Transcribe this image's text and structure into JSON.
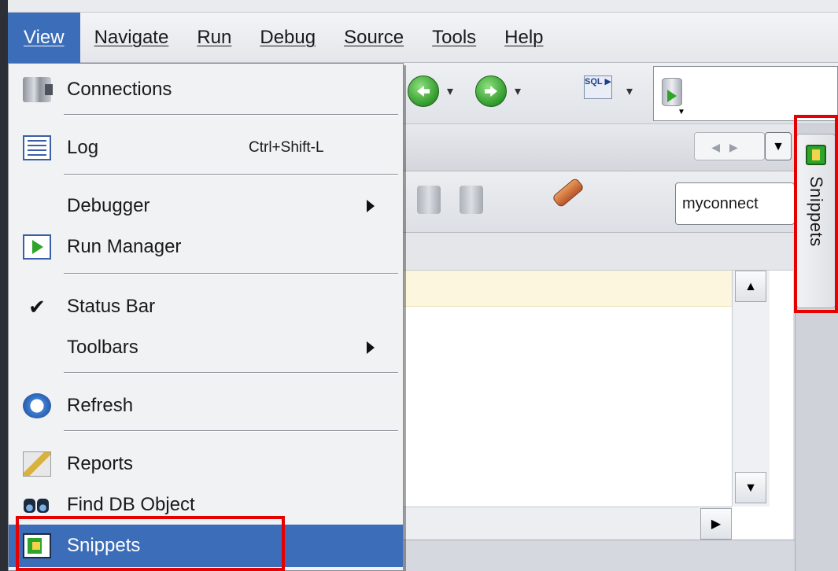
{
  "menubar": {
    "items": [
      {
        "label": "View",
        "active": true
      },
      {
        "label": "Navigate"
      },
      {
        "label": "Run"
      },
      {
        "label": "Debug"
      },
      {
        "label": "Source"
      },
      {
        "label": "Tools"
      },
      {
        "label": "Help"
      }
    ]
  },
  "view_menu": {
    "items": [
      {
        "label": "Connections",
        "icon": "connections-icon"
      },
      {
        "label": "Log",
        "shortcut": "Ctrl+Shift-L",
        "icon": "log-icon"
      },
      {
        "label": "Debugger",
        "submenu": true
      },
      {
        "label": "Run Manager",
        "icon": "run-manager-icon"
      },
      {
        "label": "Status Bar",
        "checked": true,
        "icon": "checkmark-icon"
      },
      {
        "label": "Toolbars",
        "submenu": true
      },
      {
        "label": "Refresh",
        "icon": "refresh-icon"
      },
      {
        "label": "Reports",
        "icon": "reports-icon"
      },
      {
        "label": "Find DB Object",
        "icon": "binoculars-icon"
      },
      {
        "label": "Snippets",
        "icon": "snippets-icon",
        "selected": true
      }
    ]
  },
  "toolbar": {
    "connection_select": "myconnect"
  },
  "side_panel": {
    "tab_label": "Snippets"
  },
  "colors": {
    "menu_highlight": "#3c6db8",
    "annotation_red": "#e60000"
  }
}
